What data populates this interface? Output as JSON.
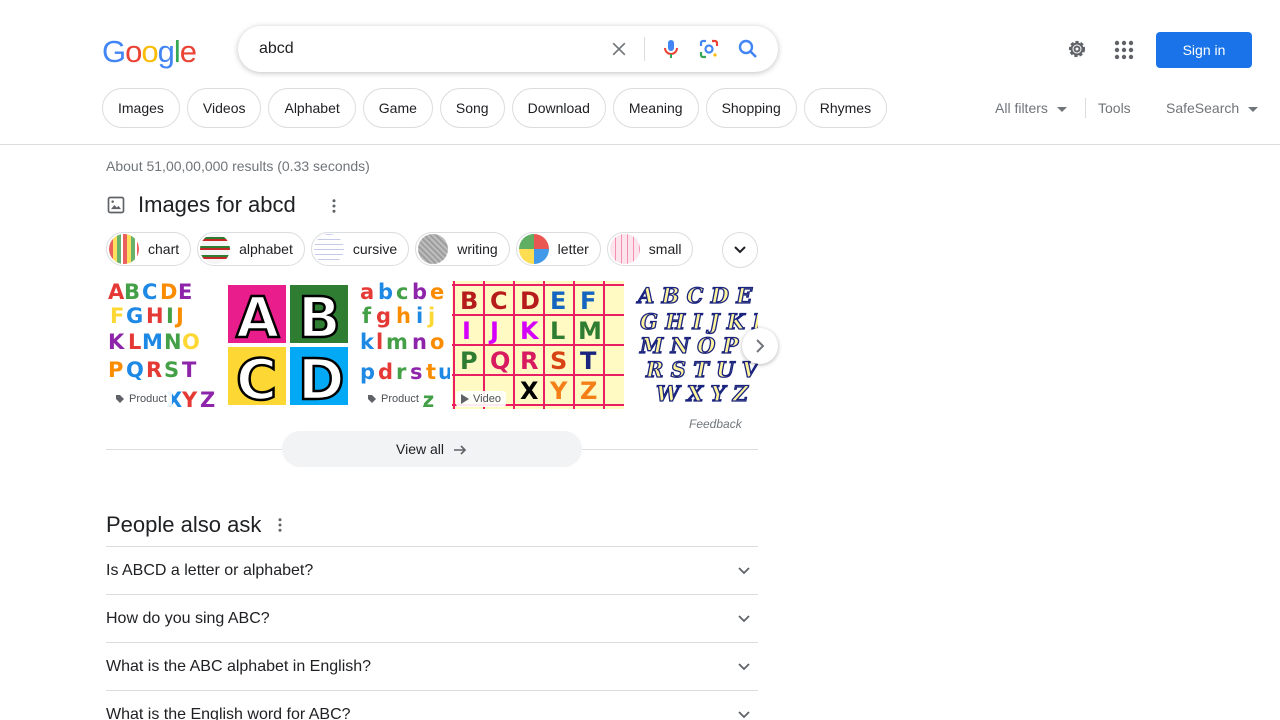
{
  "header": {
    "logo_letters": [
      {
        "ch": "G",
        "color": "#4285f4"
      },
      {
        "ch": "o",
        "color": "#ea4335"
      },
      {
        "ch": "o",
        "color": "#fbbc05"
      },
      {
        "ch": "g",
        "color": "#4285f4"
      },
      {
        "ch": "l",
        "color": "#34a853"
      },
      {
        "ch": "e",
        "color": "#ea4335"
      }
    ],
    "search_query": "abcd",
    "signin_label": "Sign in",
    "accent_color": "#1a73e8"
  },
  "filters": {
    "chips": [
      "Images",
      "Videos",
      "Alphabet",
      "Game",
      "Song",
      "Download",
      "Meaning",
      "Shopping",
      "Rhymes"
    ],
    "all_filters": "All filters",
    "tools": "Tools",
    "safesearch": "SafeSearch"
  },
  "result_stats": "About 51,00,00,000 results (0.33 seconds)",
  "images_section": {
    "title": "Images for abcd",
    "chips": [
      "chart",
      "alphabet",
      "cursive",
      "writing",
      "letter",
      "small"
    ],
    "tiles": [
      {
        "tag": "Product"
      },
      {
        "tag": ""
      },
      {
        "tag": "Product"
      },
      {
        "tag": "Video"
      },
      {
        "tag": ""
      }
    ],
    "feedback": "Feedback",
    "view_all": "View all"
  },
  "people_also_ask": {
    "title": "People also ask",
    "questions": [
      "Is ABCD a letter or alphabet?",
      "How do you sing ABC?",
      "What is the ABC alphabet in English?",
      "What is the English word for ABC?"
    ]
  }
}
